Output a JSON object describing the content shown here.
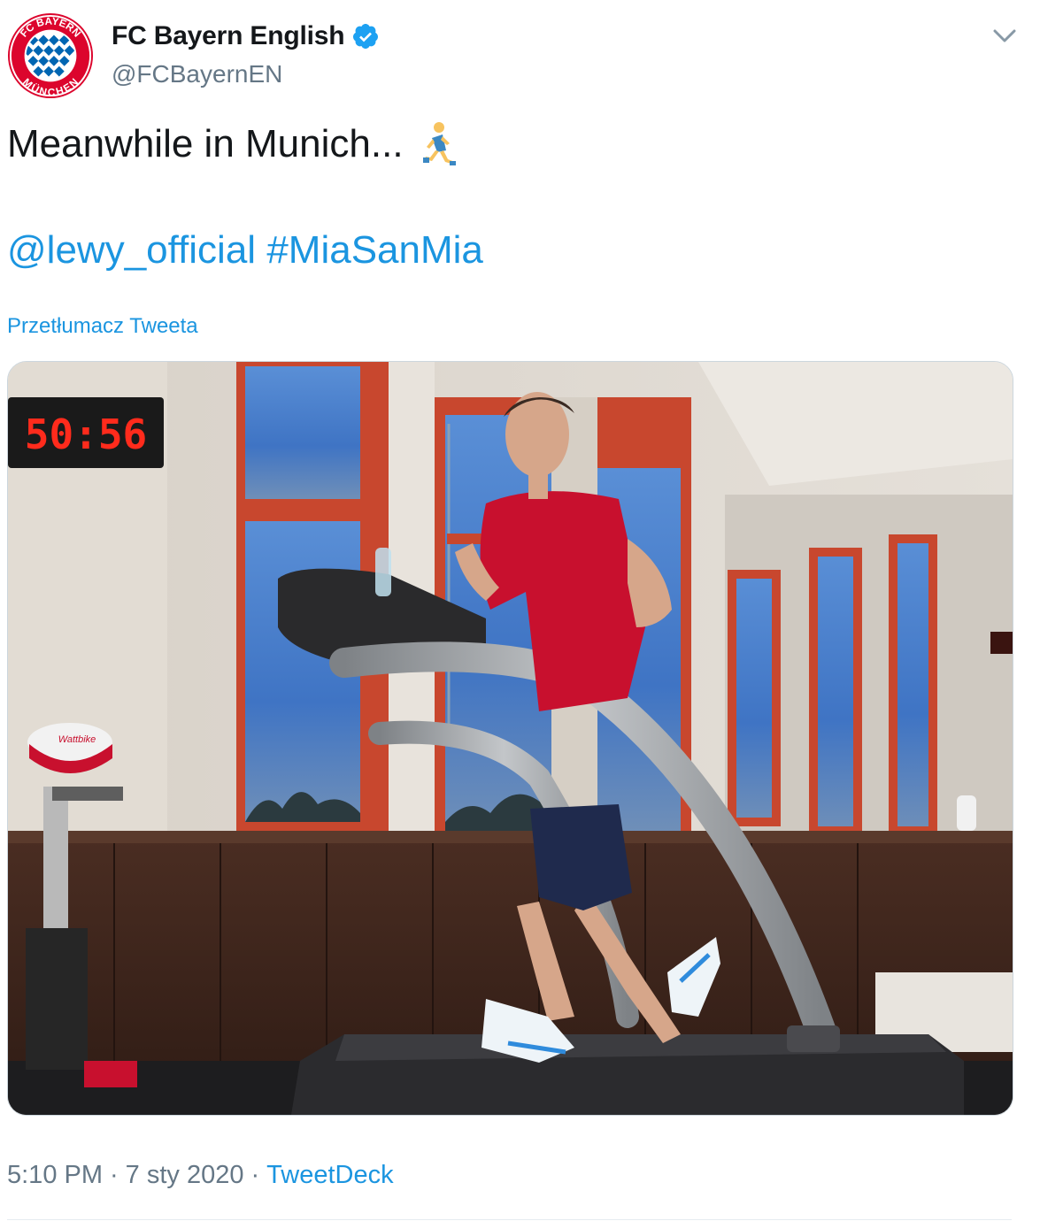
{
  "tweet": {
    "display_name": "FC Bayern English",
    "handle": "@FCBayernEN",
    "text": "Meanwhile in Munich...",
    "emoji_icon": "person-running-icon",
    "mention": "@lewy_official",
    "hashtag": "#MiaSanMia",
    "translate_label": "Przetłumacz Tweeta",
    "time": "5:10 PM",
    "date": "7 sty 2020",
    "separator": "·",
    "source": "TweetDeck",
    "avatar_text_top": "FC BAYERN",
    "avatar_text_bottom": "MÜNCHEN"
  },
  "media": {
    "clock_display": "50:56",
    "bike_brand": "Wattbike"
  },
  "colors": {
    "link": "#1b95e0",
    "muted": "#657786",
    "text": "#14171a",
    "bayern_red": "#dc052d",
    "bayern_blue": "#0066b2"
  }
}
